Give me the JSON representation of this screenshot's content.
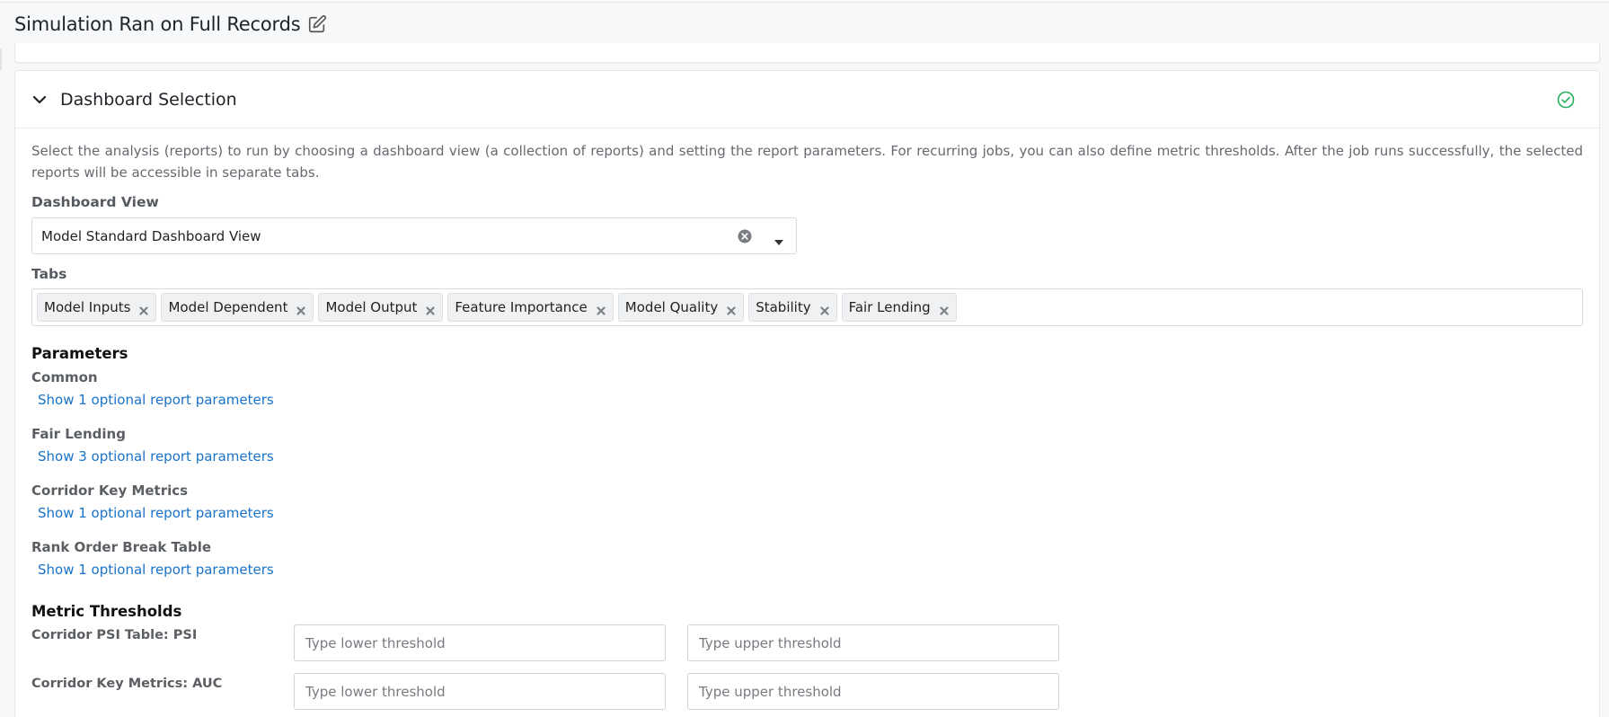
{
  "header": {
    "title": "Simulation Ran on Full Records",
    "edit_icon": "edit-icon"
  },
  "card": {
    "title": "Dashboard Selection",
    "status_icon": "check-circle-icon",
    "status_color": "#27ae60",
    "description": "Select the analysis (reports) to run by choosing a dashboard view (a collection of reports) and setting the report parameters. For recurring jobs, you can also define metric thresholds. After the job runs successfully, the selected reports will be accessible in separate tabs."
  },
  "dashboard_view": {
    "label": "Dashboard View",
    "value": "Model Standard Dashboard View"
  },
  "tabs": {
    "label": "Tabs",
    "items": [
      "Model Inputs",
      "Model Dependent",
      "Model Output",
      "Feature Importance",
      "Model Quality",
      "Stability",
      "Fair Lending"
    ]
  },
  "parameters": {
    "title": "Parameters",
    "groups": [
      {
        "label": "Common",
        "link": "Show 1 optional report parameters"
      },
      {
        "label": "Fair Lending",
        "link": "Show 3 optional report parameters"
      },
      {
        "label": "Corridor Key Metrics",
        "link": "Show 1 optional report parameters"
      },
      {
        "label": "Rank Order Break Table",
        "link": "Show 1 optional report parameters"
      }
    ]
  },
  "metric_thresholds": {
    "title": "Metric Thresholds",
    "rows": [
      {
        "label": "Corridor PSI Table: PSI",
        "lower_placeholder": "Type lower threshold",
        "upper_placeholder": "Type upper threshold"
      },
      {
        "label": "Corridor Key Metrics: AUC",
        "lower_placeholder": "Type lower threshold",
        "upper_placeholder": "Type upper threshold"
      }
    ]
  },
  "colors": {
    "link": "#1a73c9",
    "accent_check": "#27ae60"
  }
}
